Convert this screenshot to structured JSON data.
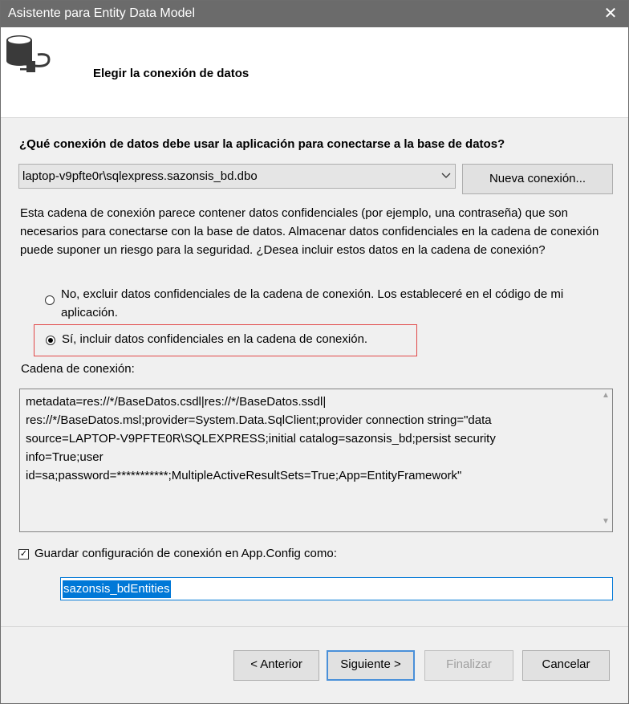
{
  "window": {
    "title": "Asistente para Entity Data Model",
    "close_glyph": "✕"
  },
  "header": {
    "title": "Elegir la conexión de datos",
    "icon": "database-plug-icon"
  },
  "question": "¿Qué conexión de datos debe usar la aplicación para conectarse a la base de datos?",
  "connection_select": {
    "value": "laptop-v9pfte0r\\sqlexpress.sazonsis_bd.dbo"
  },
  "new_connection_button": "Nueva conexión...",
  "sensitive_info": "Esta cadena de conexión parece contener datos confidenciales (por ejemplo, una contraseña) que son necesarios para conectarse con la base de datos. Almacenar datos confidenciales en la cadena de conexión puede suponer un riesgo para la seguridad. ¿Desea incluir estos datos en la cadena de conexión?",
  "options": {
    "exclude": {
      "label": "No, excluir datos confidenciales de la cadena de conexión. Los estableceré en el código de mi aplicación.",
      "selected": false
    },
    "include": {
      "label": "Sí, incluir datos confidenciales en la cadena de conexión.",
      "selected": true
    }
  },
  "connection_string_label": "Cadena de conexión:",
  "connection_string": "metadata=res://*/BaseDatos.csdl|res://*/BaseDatos.ssdl|\nres://*/BaseDatos.msl;provider=System.Data.SqlClient;provider connection string=\"data\nsource=LAPTOP-V9PFTE0R\\SQLEXPRESS;initial catalog=sazonsis_bd;persist security\ninfo=True;user\nid=sa;password=***********;MultipleActiveResultSets=True;App=EntityFramework\"",
  "save_config": {
    "label": "Guardar configuración de conexión en App.Config como:",
    "checked": true
  },
  "entity_name": "sazonsis_bdEntities",
  "buttons": {
    "previous": "< Anterior",
    "next": "Siguiente >",
    "finish": "Finalizar",
    "cancel": "Cancelar"
  },
  "colors": {
    "titlebar": "#6b6b6b",
    "accent": "#0078d7",
    "highlight_border": "#e14848"
  }
}
